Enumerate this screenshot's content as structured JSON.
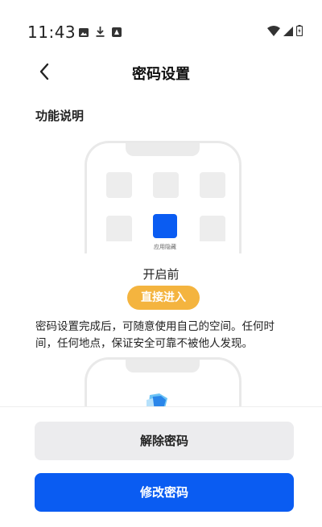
{
  "status_bar": {
    "time": "11:43",
    "left_icons": [
      "image-icon",
      "download-icon",
      "notification-icon"
    ],
    "right_icons": [
      "wifi-icon",
      "signal-icon",
      "battery-icon"
    ]
  },
  "header": {
    "back_icon": "chevron-left-icon",
    "title": "密码设置"
  },
  "feature": {
    "section_title": "功能说明",
    "mock_app_label": "应用隐藏",
    "before_label": "开启前",
    "enter_button": "直接进入",
    "description": "密码设置完成后，可随意使用自己的空间。任何时间，任何地点，保证安全可靠不被他人发现。"
  },
  "actions": {
    "remove_password": "解除密码",
    "change_password": "修改密码"
  },
  "colors": {
    "primary": "#0a5cf2",
    "accent": "#f4b43f",
    "secondary_button": "#ececee"
  }
}
